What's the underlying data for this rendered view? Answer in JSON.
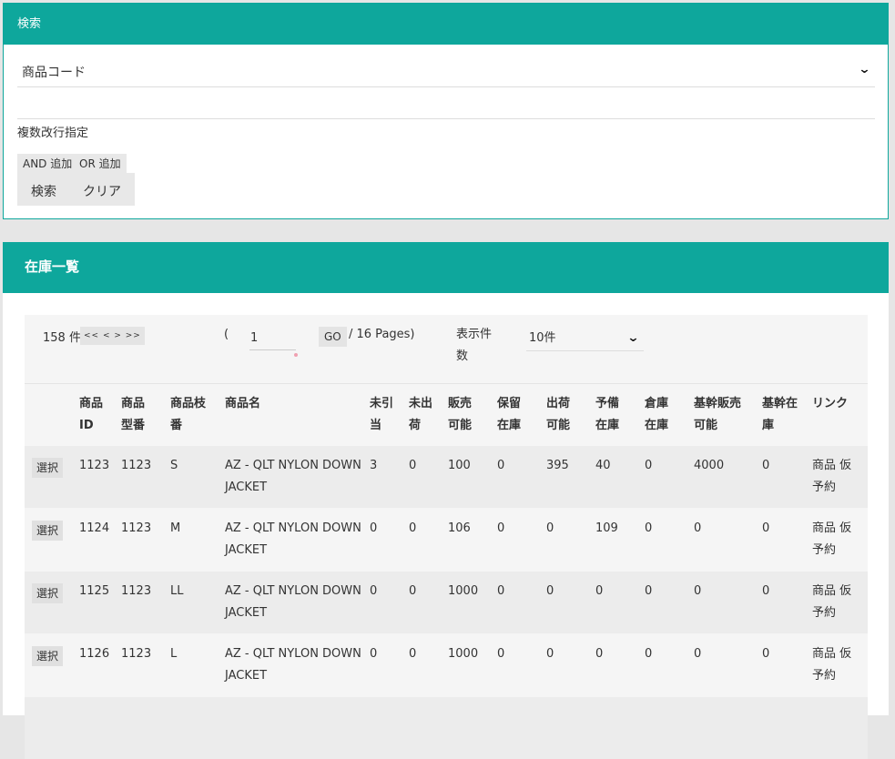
{
  "search": {
    "header": "検索",
    "field_select": "商品コード",
    "text_value": "",
    "multi_label": "複数改行指定",
    "and_add": "AND 追加",
    "or_add": "OR 追加",
    "search_btn": "検索",
    "clear_btn": "クリア"
  },
  "list": {
    "header": "在庫一覧",
    "pager": {
      "count": "158 件",
      "nav": "<<  <  >  >>",
      "open_paren": "(",
      "page": "1",
      "go": "GO",
      "total": "/ 16 Pages)",
      "perpage_label": "表示件数",
      "perpage_value": "10件"
    },
    "columns": [
      "商品ID",
      "商品型番",
      "商品枝番",
      "商品名",
      "未引当",
      "未出荷",
      "販売可能",
      "保留在庫",
      "出荷可能",
      "予備在庫",
      "倉庫在庫",
      "基幹販売可能",
      "基幹在庫",
      "リンク"
    ],
    "select_label": "選択",
    "rows": [
      {
        "id": "1123",
        "model": "1123",
        "branch": "S",
        "name": "AZ - QLT NYLON DOWN JACKET",
        "v1": "3",
        "v2": "0",
        "v3": "100",
        "v4": "0",
        "v5": "395",
        "v6": "40",
        "v7": "0",
        "v8": "4000",
        "v9": "0",
        "link": "商品 仮予約"
      },
      {
        "id": "1124",
        "model": "1123",
        "branch": "M",
        "name": "AZ - QLT NYLON DOWN JACKET",
        "v1": "0",
        "v2": "0",
        "v3": "106",
        "v4": "0",
        "v5": "0",
        "v6": "109",
        "v7": "0",
        "v8": "0",
        "v9": "0",
        "link": "商品 仮予約"
      },
      {
        "id": "1125",
        "model": "1123",
        "branch": "LL",
        "name": "AZ - QLT NYLON DOWN JACKET",
        "v1": "0",
        "v2": "0",
        "v3": "1000",
        "v4": "0",
        "v5": "0",
        "v6": "0",
        "v7": "0",
        "v8": "0",
        "v9": "0",
        "link": "商品 仮予約"
      },
      {
        "id": "1126",
        "model": "1123",
        "branch": "L",
        "name": "AZ - QLT NYLON DOWN JACKET",
        "v1": "0",
        "v2": "0",
        "v3": "1000",
        "v4": "0",
        "v5": "0",
        "v6": "0",
        "v7": "0",
        "v8": "0",
        "v9": "0",
        "link": "商品 仮予約"
      }
    ]
  }
}
